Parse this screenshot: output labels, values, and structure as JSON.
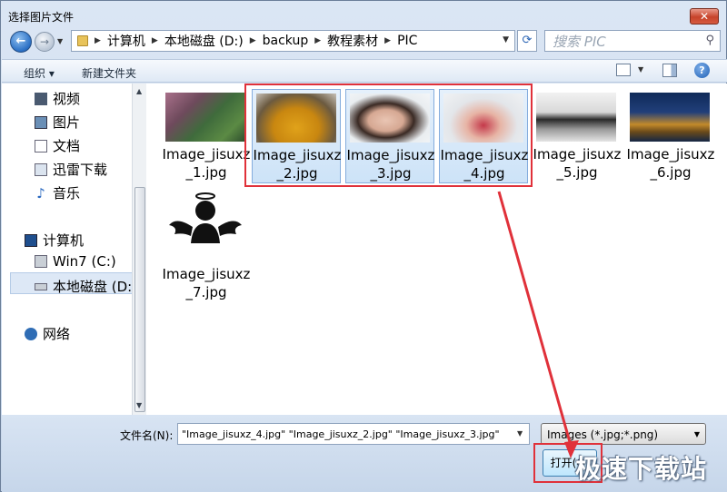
{
  "window": {
    "title": "选择图片文件",
    "close_label": "✕"
  },
  "address": {
    "crumbs": [
      "计算机",
      "本地磁盘 (D:)",
      "backup",
      "教程素材",
      "PIC"
    ],
    "search_placeholder": "搜索 PIC"
  },
  "toolbar": {
    "organize": "组织 ▾",
    "new_folder": "新建文件夹",
    "help": "?"
  },
  "nav": {
    "items": [
      {
        "label": "视频",
        "icon": "video-icon"
      },
      {
        "label": "图片",
        "icon": "pictures-icon"
      },
      {
        "label": "文档",
        "icon": "documents-icon"
      },
      {
        "label": "迅雷下载",
        "icon": "download-icon"
      },
      {
        "label": "音乐",
        "icon": "music-icon"
      },
      {
        "label": "计算机",
        "icon": "computer-icon"
      },
      {
        "label": "Win7 (C:)",
        "icon": "drive-icon"
      },
      {
        "label": "本地磁盘 (D:",
        "icon": "drive-icon"
      },
      {
        "label": "网络",
        "icon": "network-icon"
      }
    ]
  },
  "files": [
    {
      "name": "Image_jisuxz_1.jpg",
      "selected": false
    },
    {
      "name": "Image_jisuxz_2.jpg",
      "selected": true
    },
    {
      "name": "Image_jisuxz_3.jpg",
      "selected": true
    },
    {
      "name": "Image_jisuxz_4.jpg",
      "selected": true
    },
    {
      "name": "Image_jisuxz_5.jpg",
      "selected": false
    },
    {
      "name": "Image_jisuxz_6.jpg",
      "selected": false
    },
    {
      "name": "Image_jisuxz_7.jpg",
      "selected": false
    }
  ],
  "bottom": {
    "filename_label": "文件名(N):",
    "filename_value": "\"Image_jisuxz_4.jpg\" \"Image_jisuxz_2.jpg\" \"Image_jisuxz_3.jpg\"",
    "filter_value": "Images (*.jpg;*.png)",
    "open_label": "打开(O)"
  },
  "watermark": "极速下载站",
  "colors": {
    "annotation_red": "#e0313a",
    "selection_blue": "#cde3f8"
  }
}
